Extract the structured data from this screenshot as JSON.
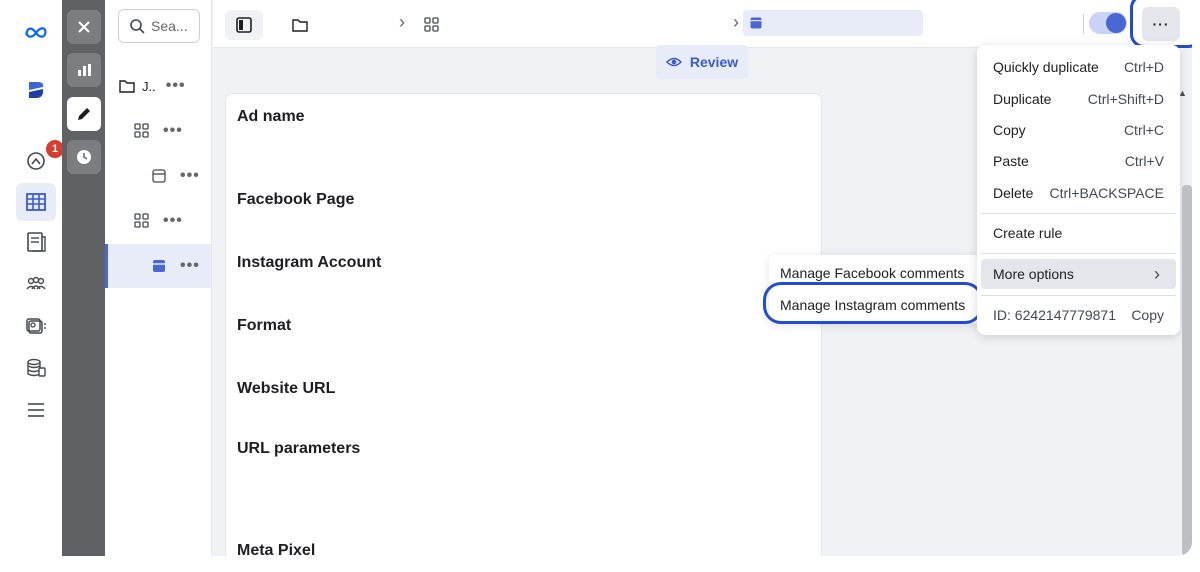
{
  "search": {
    "placeholder": "Sea..."
  },
  "tree": {
    "items": [
      {
        "label": "J.."
      }
    ]
  },
  "review_label": "Review",
  "fields": [
    "Ad name",
    "Facebook Page",
    "Instagram Account",
    "Format",
    "Website URL",
    "URL parameters",
    "Meta Pixel"
  ],
  "notifications": {
    "count": "1"
  },
  "menu": {
    "items": [
      {
        "label": "Quickly duplicate",
        "shortcut": "Ctrl+D"
      },
      {
        "label": "Duplicate",
        "shortcut": "Ctrl+Shift+D"
      },
      {
        "label": "Copy",
        "shortcut": "Ctrl+C"
      },
      {
        "label": "Paste",
        "shortcut": "Ctrl+V"
      },
      {
        "label": "Delete",
        "shortcut": "Ctrl+BACKSPACE"
      }
    ],
    "create_rule": "Create rule",
    "more_options": "More options",
    "id_text": "ID: 6242147779871",
    "copy_id": "Copy"
  },
  "submenu": {
    "items": [
      "Manage Facebook comments",
      "Manage Instagram comments"
    ]
  },
  "colors": {
    "accent": "#4a67d6",
    "highlight_ring": "#1f4bd8",
    "badge": "#d63e2f"
  }
}
